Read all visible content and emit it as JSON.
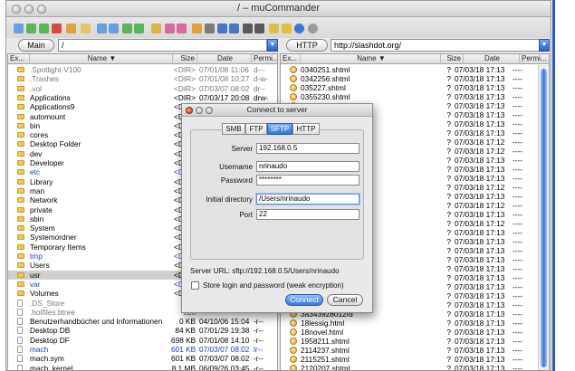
{
  "window": {
    "title": "/ – muCommander"
  },
  "toolbar": {
    "icons": [
      "new-window-icon",
      "back-icon",
      "forward-icon",
      "stop-icon",
      "refresh-icon",
      "home-icon",
      "mark-icon",
      "unmark-icon",
      "swap-icon",
      "sync-icon",
      "compare-icon",
      "bookmark-icon",
      "bookmark-add-icon",
      "connect-icon",
      "disconnect-icon",
      "email-icon",
      "pack-icon",
      "unpack-icon",
      "console-icon",
      "run-icon",
      "prefs-icon",
      "info-icon",
      "help-icon"
    ]
  },
  "left": {
    "location_button": "Main",
    "path": "/",
    "headers": {
      "ext": "Ex...",
      "name": "Name",
      "size": "Size",
      "date": "Date",
      "perm": "Permi..."
    },
    "rows": [
      {
        "name": ".Spotlight-V100",
        "size": "<DIR>",
        "date": "07/01/08 11:06",
        "perm": "d---",
        "style": "grey",
        "icon": "folder"
      },
      {
        "name": ".Trashes",
        "size": "<DIR>",
        "date": "07/01/08 10:27",
        "perm": "d-w-",
        "style": "grey",
        "icon": "folder"
      },
      {
        "name": ".vol",
        "size": "<DIR>",
        "date": "07/03/07 08:02",
        "perm": "dr--",
        "style": "grey",
        "icon": "folder"
      },
      {
        "name": "Applications",
        "size": "<DIR>",
        "date": "07/03/17 20:08",
        "perm": "drw-",
        "style": "normal",
        "icon": "folder"
      },
      {
        "name": "Applications9",
        "size": "<DIR>",
        "date": "03/09/29 19:27",
        "perm": "drw-",
        "style": "normal",
        "icon": "folder"
      },
      {
        "name": "automount",
        "size": "<DIR>",
        "date": "",
        "perm": "",
        "style": "normal",
        "icon": "folder"
      },
      {
        "name": "bin",
        "size": "<DIR>",
        "date": "",
        "perm": "",
        "style": "normal",
        "icon": "folder"
      },
      {
        "name": "cores",
        "size": "<DIR>",
        "date": "",
        "perm": "",
        "style": "normal",
        "icon": "folder"
      },
      {
        "name": "Desktop Folder",
        "size": "<DIR>",
        "date": "",
        "perm": "",
        "style": "normal",
        "icon": "folder"
      },
      {
        "name": "dev",
        "size": "<DIR>",
        "date": "",
        "perm": "",
        "style": "normal",
        "icon": "folder"
      },
      {
        "name": "Developer",
        "size": "<DIR>",
        "date": "",
        "perm": "",
        "style": "normal",
        "icon": "folder"
      },
      {
        "name": "etc",
        "size": "<DIR>",
        "date": "",
        "perm": "",
        "style": "blue",
        "icon": "folder"
      },
      {
        "name": "Library",
        "size": "<DIR>",
        "date": "",
        "perm": "",
        "style": "normal",
        "icon": "folder"
      },
      {
        "name": "man",
        "size": "<DIR>",
        "date": "",
        "perm": "",
        "style": "normal",
        "icon": "folder"
      },
      {
        "name": "Network",
        "size": "<DIR>",
        "date": "",
        "perm": "",
        "style": "normal",
        "icon": "folder"
      },
      {
        "name": "private",
        "size": "<DIR>",
        "date": "",
        "perm": "",
        "style": "normal",
        "icon": "folder"
      },
      {
        "name": "sbin",
        "size": "<DIR>",
        "date": "",
        "perm": "",
        "style": "normal",
        "icon": "folder"
      },
      {
        "name": "System",
        "size": "<DIR>",
        "date": "",
        "perm": "",
        "style": "normal",
        "icon": "folder"
      },
      {
        "name": "Systemordner",
        "size": "<DIR>",
        "date": "",
        "perm": "",
        "style": "normal",
        "icon": "folder"
      },
      {
        "name": "Temporary Items",
        "size": "<DIR>",
        "date": "",
        "perm": "",
        "style": "normal",
        "icon": "folder"
      },
      {
        "name": "tmp",
        "size": "<DIR>",
        "date": "",
        "perm": "",
        "style": "blue",
        "icon": "folder"
      },
      {
        "name": "Users",
        "size": "<DIR>",
        "date": "",
        "perm": "",
        "style": "normal",
        "icon": "folder"
      },
      {
        "name": "usr",
        "size": "<DIR>",
        "date": "",
        "perm": "",
        "style": "sel",
        "icon": "folder"
      },
      {
        "name": "var",
        "size": "<DIR>",
        "date": "",
        "perm": "",
        "style": "blue",
        "icon": "folder"
      },
      {
        "name": "Volumes",
        "size": "<DIR>",
        "date": "",
        "perm": "",
        "style": "normal",
        "icon": "folder"
      },
      {
        "name": ".DS_Store",
        "size": "6.0",
        "date": "",
        "perm": "",
        "style": "grey",
        "icon": "doc"
      },
      {
        "name": ".hotfiles.btree",
        "size": "128",
        "date": "",
        "perm": "",
        "style": "grey",
        "icon": "doc"
      },
      {
        "name": "Benutzerhandbücher und Informationen",
        "size": "0 KB",
        "date": "04/10/06 15:04",
        "perm": "-r--",
        "style": "normal",
        "icon": "doc"
      },
      {
        "name": "Desktop DB",
        "size": "84 KB",
        "date": "07/01/29 19:38",
        "perm": "-r--",
        "style": "normal",
        "icon": "doc"
      },
      {
        "name": "Desktop DF",
        "size": "698 KB",
        "date": "07/01/08 14:10",
        "perm": "-r--",
        "style": "normal",
        "icon": "doc"
      },
      {
        "name": "mach",
        "size": "601 KB",
        "date": "07/03/07 08:02",
        "perm": "lr--",
        "style": "blue",
        "icon": "doc"
      },
      {
        "name": "mach.sym",
        "size": "601 KB",
        "date": "07/03/07 08:02",
        "perm": "-r--",
        "style": "normal",
        "icon": "doc"
      },
      {
        "name": "mach_kernel",
        "size": "8.1 MB",
        "date": "06/09/26 03:45",
        "perm": "-r--",
        "style": "normal",
        "icon": "doc"
      }
    ]
  },
  "right": {
    "location_button": "HTTP",
    "path": "http://slashdot.org/",
    "headers": {
      "ext": "Ex...",
      "name": "Name",
      "size": "Size",
      "date": "Date",
      "perm": "Permi..."
    },
    "rows": [
      {
        "name": "0340251.shtml",
        "size": "?",
        "date": "07/03/18 17:13",
        "perm": "----"
      },
      {
        "name": "0342256.shtml",
        "size": "?",
        "date": "07/03/18 17:13",
        "perm": "----"
      },
      {
        "name": "035227.shtml",
        "size": "?",
        "date": "07/03/18 17:13",
        "perm": "----"
      },
      {
        "name": "0355230.shtml",
        "size": "?",
        "date": "07/03/18 17:13",
        "perm": "----"
      },
      {
        "name": "040219.shtml",
        "size": "?",
        "date": "07/03/18 17:13",
        "perm": "----"
      },
      {
        "name": "",
        "size": "?",
        "date": "07/03/18 17:13",
        "perm": "----"
      },
      {
        "name": "",
        "size": "?",
        "date": "07/03/18 17:13",
        "perm": "----"
      },
      {
        "name": "",
        "size": "?",
        "date": "07/03/18 17:13",
        "perm": "----"
      },
      {
        "name": "",
        "size": "?",
        "date": "07/03/18 17:12",
        "perm": "----"
      },
      {
        "name": "",
        "size": "?",
        "date": "07/03/18 17:12",
        "perm": "----"
      },
      {
        "name": "948b2fe7a5296",
        "size": "?",
        "date": "07/03/18 17:13",
        "perm": "----"
      },
      {
        "name": "",
        "size": "?",
        "date": "07/03/18 17:13",
        "perm": "----"
      },
      {
        "name": "",
        "size": "?",
        "date": "07/03/18 17:13",
        "perm": "----"
      },
      {
        "name": "",
        "size": "?",
        "date": "07/03/18 17:12",
        "perm": "----"
      },
      {
        "name": "595e0a6f66d671",
        "size": "?",
        "date": "07/03/18 17:13",
        "perm": "----"
      },
      {
        "name": "",
        "size": "?",
        "date": "07/03/18 17:12",
        "perm": "----"
      },
      {
        "name": "",
        "size": "?",
        "date": "07/03/18 17:13",
        "perm": "----"
      },
      {
        "name": "",
        "size": "?",
        "date": "07/03/18 17:12",
        "perm": "----"
      },
      {
        "name": "",
        "size": "?",
        "date": "07/03/18 17:13",
        "perm": "----"
      },
      {
        "name": "",
        "size": "?",
        "date": "07/03/18 17:13",
        "perm": "----"
      },
      {
        "name": "",
        "size": "?",
        "date": "07/03/18 17:13",
        "perm": "----"
      },
      {
        "name": "",
        "size": "?",
        "date": "07/03/18 17:13",
        "perm": "----"
      },
      {
        "name": "",
        "size": "?",
        "date": "07/03/18 17:13",
        "perm": "----"
      },
      {
        "name": "",
        "size": "?",
        "date": "07/03/18 17:13",
        "perm": "----"
      },
      {
        "name": "",
        "size": "?",
        "date": "07/03/18 17:13",
        "perm": "----"
      },
      {
        "name": "",
        "size": "?",
        "date": "07/03/18 17:13",
        "perm": "----"
      },
      {
        "name": "",
        "size": "?",
        "date": "07/03/18 17:13",
        "perm": "----"
      },
      {
        "name": "3a343928012fd",
        "size": "?",
        "date": "07/03/18 17:13",
        "perm": "----"
      },
      {
        "name": "18lessig.html",
        "size": "?",
        "date": "07/03/18 17:13",
        "perm": "----"
      },
      {
        "name": "18novel.html",
        "size": "?",
        "date": "07/03/18 17:13",
        "perm": "----"
      },
      {
        "name": "1958211.shtml",
        "size": "?",
        "date": "07/03/18 17:13",
        "perm": "----"
      },
      {
        "name": "2114237.shtml",
        "size": "?",
        "date": "07/03/18 17:13",
        "perm": "----"
      },
      {
        "name": "2115251.shtml",
        "size": "?",
        "date": "07/03/18 17:13",
        "perm": "----"
      },
      {
        "name": "2120207.shtml",
        "size": "?",
        "date": "07/03/18 17:13",
        "perm": "----"
      }
    ]
  },
  "dialog": {
    "title": "Connect to server",
    "tabs": [
      "SMB",
      "FTP",
      "SFTP",
      "HTTP"
    ],
    "active_tab": "SFTP",
    "fields": {
      "server_label": "Server",
      "server_value": "192.168.0.5",
      "username_label": "Username",
      "username_value": "nrinaudo",
      "password_label": "Password",
      "password_value": "********",
      "initdir_label": "Initial directory",
      "initdir_value": "/Users/nrinaudo",
      "port_label": "Port",
      "port_value": "22"
    },
    "server_url": "Server URL: sftp://192.168.0.5/Users/nrinaudo",
    "store_login_label": "Store login and password (weak encryption)",
    "connect_label": "Connect",
    "cancel_label": "Cancel"
  },
  "colors": {
    "accent": "#3a76d8",
    "folder": "#f3c658",
    "link_blue": "#1b3fb8",
    "selection": "#cfcfcf"
  }
}
